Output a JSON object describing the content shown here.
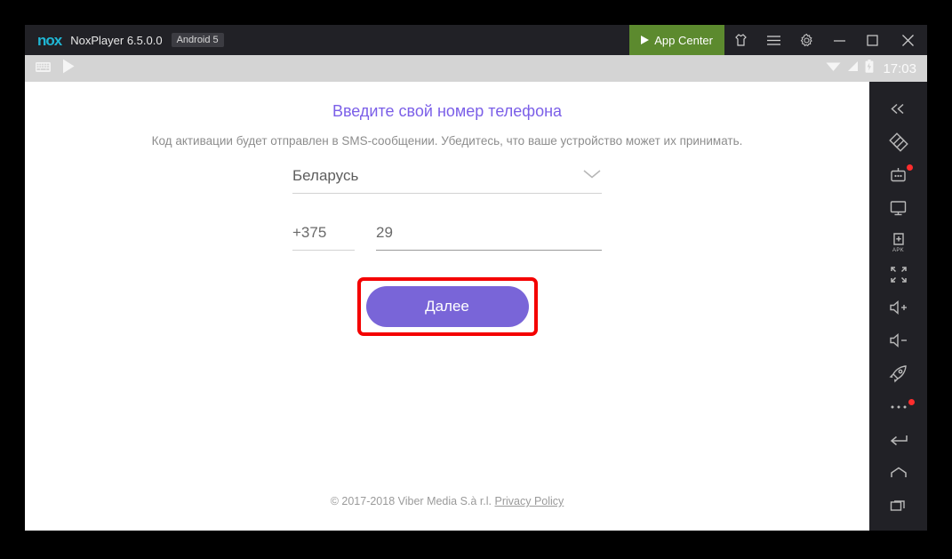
{
  "window": {
    "logo": "nox",
    "title": "NoxPlayer 6.5.0.0",
    "android_badge": "Android 5",
    "app_center_label": "App Center",
    "controls": [
      {
        "name": "tshirt-theme-icon",
        "glyph": "shirt"
      },
      {
        "name": "menu-icon",
        "glyph": "hamburger"
      },
      {
        "name": "settings-gear-icon",
        "glyph": "gear"
      },
      {
        "name": "minimize-icon",
        "glyph": "minimize"
      },
      {
        "name": "maximize-icon",
        "glyph": "maximize"
      },
      {
        "name": "close-icon",
        "glyph": "close"
      }
    ]
  },
  "statusbar": {
    "notifications": [
      "keyboard-icon",
      "play-store-icon"
    ],
    "wifi": "wifi-icon",
    "signal": "signal-icon",
    "battery": "battery-icon",
    "time": "17:03"
  },
  "viber": {
    "heading": "Введите свой номер телефона",
    "subheading": "Код активации будет отправлен в SMS-сообщении. Убедитесь, что ваше устройство может их принимать.",
    "country": "Беларусь",
    "country_code": "+375",
    "phone_number": "29",
    "next_button": "Далее",
    "copyright": "© 2017-2018 Viber Media S.à r.l.",
    "privacy_link": "Privacy Policy",
    "heading_color": "#7b5fe8",
    "button_color": "#7965d8",
    "highlight_color": "#f40000"
  },
  "sidebar": {
    "items": [
      {
        "name": "collapse-sidebar-icon",
        "badge": false
      },
      {
        "name": "multi-instance-icon",
        "badge": false
      },
      {
        "name": "macro-recorder-icon",
        "badge": true
      },
      {
        "name": "screenshot-icon",
        "badge": false
      },
      {
        "name": "install-apk-icon",
        "badge": false
      },
      {
        "name": "fullscreen-icon",
        "badge": false
      },
      {
        "name": "volume-up-icon",
        "badge": false
      },
      {
        "name": "volume-down-icon",
        "badge": false
      },
      {
        "name": "boost-rocket-icon",
        "badge": false
      },
      {
        "name": "more-options-icon",
        "badge": true
      }
    ],
    "nav": [
      {
        "name": "android-back-icon"
      },
      {
        "name": "android-home-icon"
      },
      {
        "name": "android-recents-icon"
      }
    ]
  }
}
